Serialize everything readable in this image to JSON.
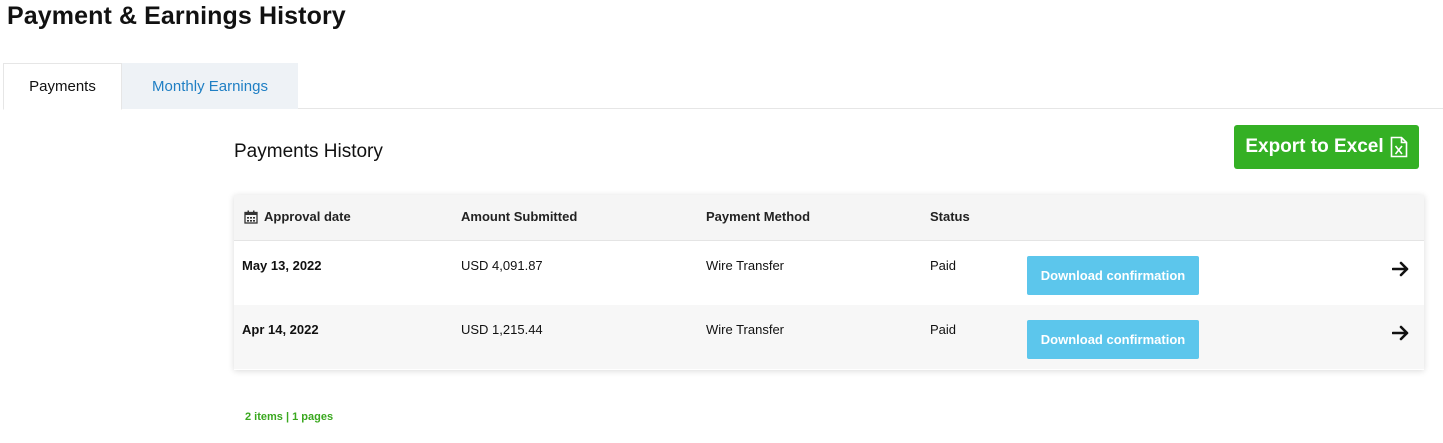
{
  "page": {
    "title": "Payment & Earnings History"
  },
  "tabs": [
    {
      "label": "Payments",
      "active": true
    },
    {
      "label": "Monthly Earnings",
      "active": false
    }
  ],
  "section": {
    "title": "Payments History"
  },
  "export_button": {
    "label": "Export to Excel",
    "icon": "excel-file-icon",
    "color": "#34b024"
  },
  "table": {
    "headers": {
      "approval_date": "Approval date",
      "amount": "Amount Submitted",
      "method": "Payment Method",
      "status": "Status"
    },
    "rows": [
      {
        "date": "May 13, 2022",
        "amount": "USD 4,091.87",
        "method": "Wire Transfer",
        "status": "Paid",
        "action": "Download confirmation"
      },
      {
        "date": "Apr 14, 2022",
        "amount": "USD 1,215.44",
        "method": "Wire Transfer",
        "status": "Paid",
        "action": "Download confirmation"
      }
    ]
  },
  "pagination": {
    "summary": "2 items | 1 pages"
  },
  "colors": {
    "accent_green": "#34b024",
    "download_blue": "#5cc6ec",
    "link_blue": "#1f7fc4"
  }
}
